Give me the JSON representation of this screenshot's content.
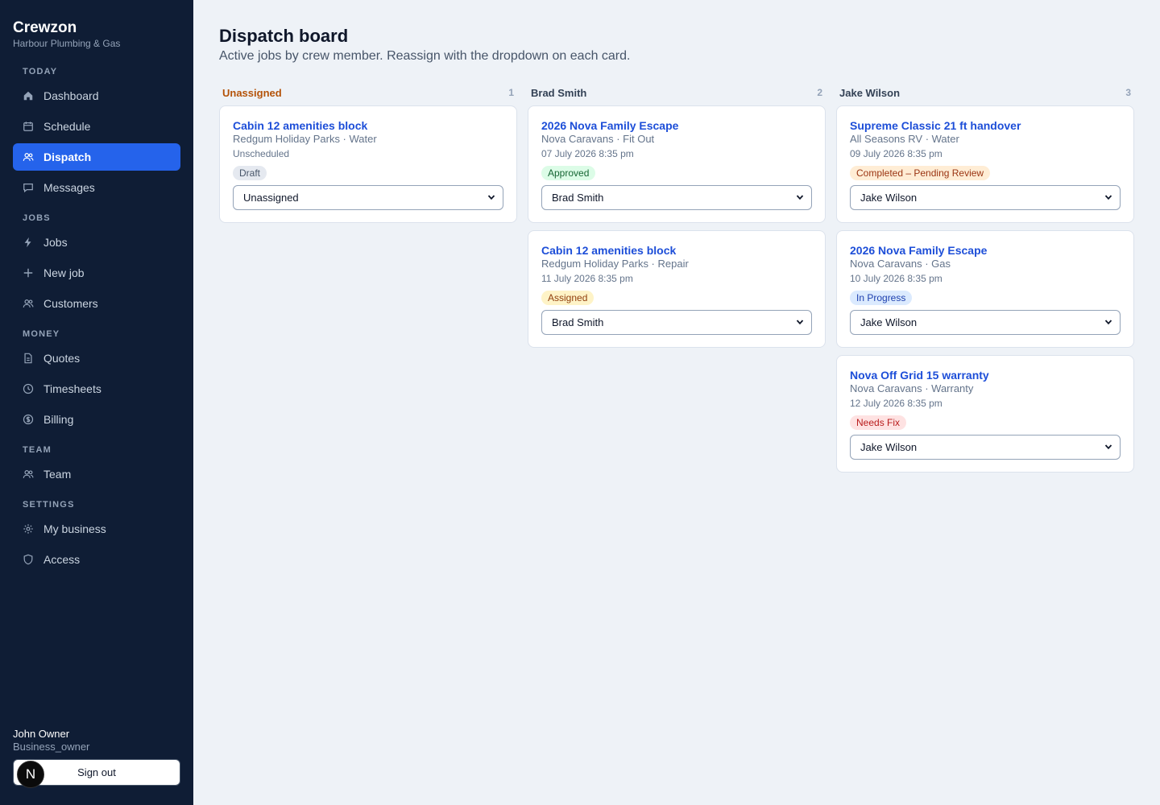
{
  "brand": {
    "name": "Crewzon",
    "subtitle": "Harbour Plumbing & Gas"
  },
  "sidebar": {
    "sections": [
      {
        "title": "TODAY",
        "items": [
          {
            "label": "Dashboard",
            "icon": "home-icon"
          },
          {
            "label": "Schedule",
            "icon": "calendar-icon"
          },
          {
            "label": "Dispatch",
            "icon": "users-icon",
            "active": true
          },
          {
            "label": "Messages",
            "icon": "message-icon"
          }
        ]
      },
      {
        "title": "JOBS",
        "items": [
          {
            "label": "Jobs",
            "icon": "bolt-icon"
          },
          {
            "label": "New job",
            "icon": "plus-icon"
          },
          {
            "label": "Customers",
            "icon": "users-icon"
          }
        ]
      },
      {
        "title": "MONEY",
        "items": [
          {
            "label": "Quotes",
            "icon": "document-icon"
          },
          {
            "label": "Timesheets",
            "icon": "clock-icon"
          },
          {
            "label": "Billing",
            "icon": "dollar-circle-icon"
          }
        ]
      },
      {
        "title": "TEAM",
        "items": [
          {
            "label": "Team",
            "icon": "users-icon"
          }
        ]
      },
      {
        "title": "SETTINGS",
        "items": [
          {
            "label": "My business",
            "icon": "gear-icon"
          },
          {
            "label": "Access",
            "icon": "shield-icon"
          }
        ]
      }
    ]
  },
  "user": {
    "name": "John Owner",
    "role": "Business_owner",
    "sign_out_label": "Sign out",
    "avatar_letter": "N"
  },
  "page": {
    "title": "Dispatch board",
    "subtitle": "Active jobs by crew member. Reassign with the dropdown on each card."
  },
  "crew_options": [
    "Unassigned",
    "Brad Smith",
    "Jake Wilson"
  ],
  "columns": [
    {
      "name": "Unassigned",
      "count": "1",
      "cards": [
        {
          "title": "Cabin 12 amenities block",
          "meta": "Redgum Holiday Parks · Water",
          "date": "Unscheduled",
          "status": "Draft",
          "status_kind": "draft",
          "assignee": "Unassigned"
        }
      ]
    },
    {
      "name": "Brad Smith",
      "count": "2",
      "cards": [
        {
          "title": "2026 Nova Family Escape",
          "meta": "Nova Caravans · Fit Out",
          "date": "07 July 2026 8:35 pm",
          "status": "Approved",
          "status_kind": "approved",
          "assignee": "Brad Smith"
        },
        {
          "title": "Cabin 12 amenities block",
          "meta": "Redgum Holiday Parks · Repair",
          "date": "11 July 2026 8:35 pm",
          "status": "Assigned",
          "status_kind": "assigned",
          "assignee": "Brad Smith"
        }
      ]
    },
    {
      "name": "Jake Wilson",
      "count": "3",
      "cards": [
        {
          "title": "Supreme Classic 21 ft handover",
          "meta": "All Seasons RV · Water",
          "date": "09 July 2026 8:35 pm",
          "status": "Completed – Pending Review",
          "status_kind": "review",
          "assignee": "Jake Wilson"
        },
        {
          "title": "2026 Nova Family Escape",
          "meta": "Nova Caravans · Gas",
          "date": "10 July 2026 8:35 pm",
          "status": "In Progress",
          "status_kind": "progress",
          "assignee": "Jake Wilson"
        },
        {
          "title": "Nova Off Grid 15 warranty",
          "meta": "Nova Caravans · Warranty",
          "date": "12 July 2026 8:35 pm",
          "status": "Needs Fix",
          "status_kind": "fix",
          "assignee": "Jake Wilson"
        }
      ]
    }
  ],
  "colors": {
    "sidebar_bg": "#0f1d35",
    "accent": "#2563eb",
    "page_bg": "#eef2f7",
    "link": "#1d4ed8"
  }
}
